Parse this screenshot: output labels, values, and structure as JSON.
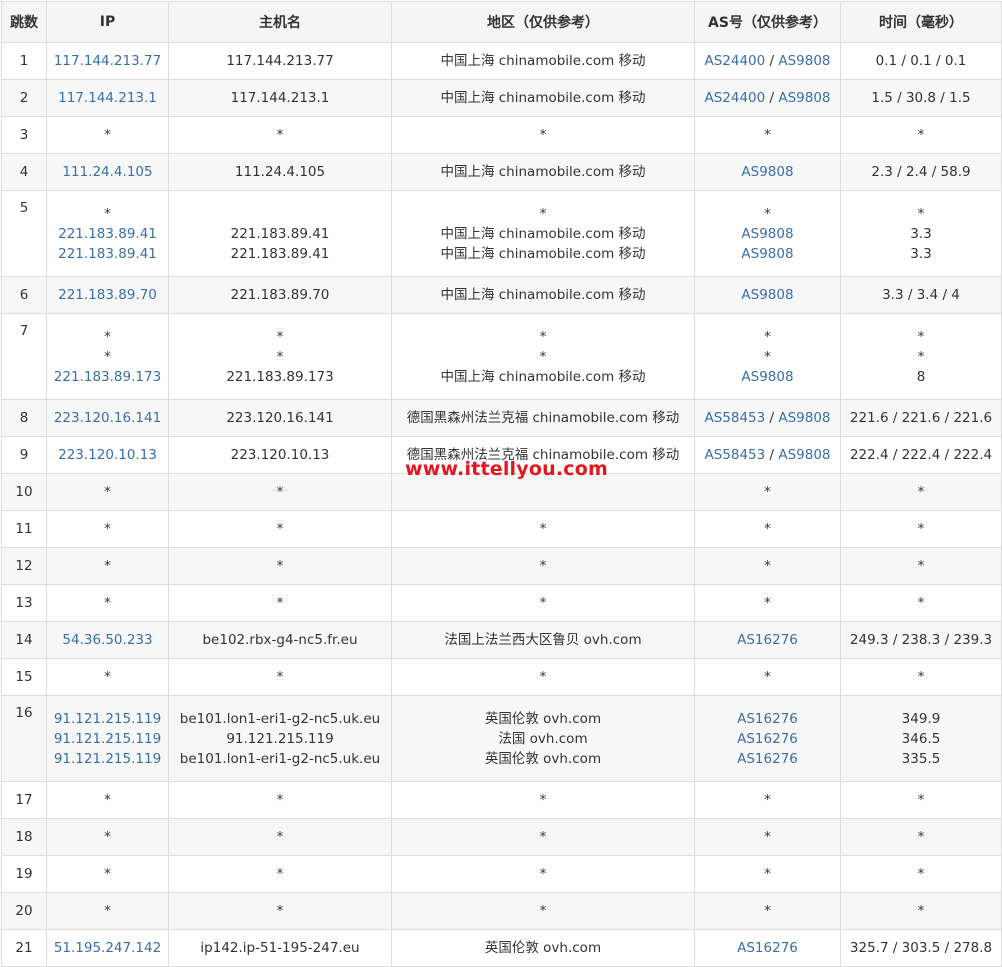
{
  "headers": [
    "跳数",
    "IP",
    "主机名",
    "地区（仅供参考）",
    "AS号（仅供参考）",
    "时间（毫秒）"
  ],
  "watermark": "www.ittellyou.com",
  "colors": {
    "link": "#3a6ea8",
    "watermark": "#e6161f",
    "border": "#dddddd",
    "stripe": "#f7f7f7"
  },
  "rows": [
    {
      "hop": "1",
      "lines": [
        {
          "ip": "117.144.213.77",
          "host": "117.144.213.77",
          "region": "中国上海 chinamobile.com 移动",
          "as": [
            "AS24400",
            "AS9808"
          ],
          "time": "0.1 / 0.1 / 0.1"
        }
      ]
    },
    {
      "hop": "2",
      "lines": [
        {
          "ip": "117.144.213.1",
          "host": "117.144.213.1",
          "region": "中国上海 chinamobile.com 移动",
          "as": [
            "AS24400",
            "AS9808"
          ],
          "time": "1.5 / 30.8 / 1.5"
        }
      ]
    },
    {
      "hop": "3",
      "lines": [
        {
          "ip": "*",
          "host": "*",
          "region": "*",
          "as": [
            "*"
          ],
          "time": "*"
        }
      ]
    },
    {
      "hop": "4",
      "lines": [
        {
          "ip": "111.24.4.105",
          "host": "111.24.4.105",
          "region": "中国上海 chinamobile.com 移动",
          "as": [
            "AS9808"
          ],
          "time": "2.3 / 2.4 / 58.9"
        }
      ]
    },
    {
      "hop": "5",
      "lines": [
        {
          "ip": "*",
          "host": "",
          "region": "*",
          "as": [
            "*"
          ],
          "time": "*"
        },
        {
          "ip": "221.183.89.41",
          "host": "221.183.89.41",
          "region": "中国上海 chinamobile.com 移动",
          "as": [
            "AS9808"
          ],
          "time": "3.3"
        },
        {
          "ip": "221.183.89.41",
          "host": "221.183.89.41",
          "region": "中国上海 chinamobile.com 移动",
          "as": [
            "AS9808"
          ],
          "time": "3.3"
        }
      ]
    },
    {
      "hop": "6",
      "lines": [
        {
          "ip": "221.183.89.70",
          "host": "221.183.89.70",
          "region": "中国上海 chinamobile.com 移动",
          "as": [
            "AS9808"
          ],
          "time": "3.3 / 3.4 / 4"
        }
      ]
    },
    {
      "hop": "7",
      "lines": [
        {
          "ip": "*",
          "host": "*",
          "region": "*",
          "as": [
            "*"
          ],
          "time": "*"
        },
        {
          "ip": "*",
          "host": "*",
          "region": "*",
          "as": [
            "*"
          ],
          "time": "*"
        },
        {
          "ip": "221.183.89.173",
          "host": "221.183.89.173",
          "region": "中国上海 chinamobile.com 移动",
          "as": [
            "AS9808"
          ],
          "time": "8"
        }
      ]
    },
    {
      "hop": "8",
      "lines": [
        {
          "ip": "223.120.16.141",
          "host": "223.120.16.141",
          "region": "德国黑森州法兰克福 chinamobile.com 移动",
          "as": [
            "AS58453",
            "AS9808"
          ],
          "time": "221.6 / 221.6 / 221.6"
        }
      ]
    },
    {
      "hop": "9",
      "lines": [
        {
          "ip": "223.120.10.13",
          "host": "223.120.10.13",
          "region": "德国黑森州法兰克福 chinamobile.com 移动",
          "as": [
            "AS58453",
            "AS9808"
          ],
          "time": "222.4 / 222.4 / 222.4"
        }
      ]
    },
    {
      "hop": "10",
      "lines": [
        {
          "ip": "*",
          "host": "*",
          "region": "",
          "as": [
            "*"
          ],
          "time": "*"
        }
      ]
    },
    {
      "hop": "11",
      "lines": [
        {
          "ip": "*",
          "host": "*",
          "region": "*",
          "as": [
            "*"
          ],
          "time": "*"
        }
      ]
    },
    {
      "hop": "12",
      "lines": [
        {
          "ip": "*",
          "host": "*",
          "region": "*",
          "as": [
            "*"
          ],
          "time": "*"
        }
      ]
    },
    {
      "hop": "13",
      "lines": [
        {
          "ip": "*",
          "host": "*",
          "region": "*",
          "as": [
            "*"
          ],
          "time": "*"
        }
      ]
    },
    {
      "hop": "14",
      "lines": [
        {
          "ip": "54.36.50.233",
          "host": "be102.rbx-g4-nc5.fr.eu",
          "region": "法国上法兰西大区鲁贝 ovh.com",
          "as": [
            "AS16276"
          ],
          "time": "249.3 / 238.3 / 239.3"
        }
      ]
    },
    {
      "hop": "15",
      "lines": [
        {
          "ip": "*",
          "host": "*",
          "region": "*",
          "as": [
            "*"
          ],
          "time": "*"
        }
      ]
    },
    {
      "hop": "16",
      "lines": [
        {
          "ip": "91.121.215.119",
          "host": "be101.lon1-eri1-g2-nc5.uk.eu",
          "region": "英国伦敦 ovh.com",
          "as": [
            "AS16276"
          ],
          "time": "349.9"
        },
        {
          "ip": "91.121.215.119",
          "host": "91.121.215.119",
          "region": "法国 ovh.com",
          "as": [
            "AS16276"
          ],
          "time": "346.5"
        },
        {
          "ip": "91.121.215.119",
          "host": "be101.lon1-eri1-g2-nc5.uk.eu",
          "region": "英国伦敦 ovh.com",
          "as": [
            "AS16276"
          ],
          "time": "335.5"
        }
      ]
    },
    {
      "hop": "17",
      "lines": [
        {
          "ip": "*",
          "host": "*",
          "region": "*",
          "as": [
            "*"
          ],
          "time": "*"
        }
      ]
    },
    {
      "hop": "18",
      "lines": [
        {
          "ip": "*",
          "host": "*",
          "region": "*",
          "as": [
            "*"
          ],
          "time": "*"
        }
      ]
    },
    {
      "hop": "19",
      "lines": [
        {
          "ip": "*",
          "host": "*",
          "region": "*",
          "as": [
            "*"
          ],
          "time": "*"
        }
      ]
    },
    {
      "hop": "20",
      "lines": [
        {
          "ip": "*",
          "host": "*",
          "region": "*",
          "as": [
            "*"
          ],
          "time": "*"
        }
      ]
    },
    {
      "hop": "21",
      "lines": [
        {
          "ip": "51.195.247.142",
          "host": "ip142.ip-51-195-247.eu",
          "region": "英国伦敦 ovh.com",
          "as": [
            "AS16276"
          ],
          "time": "325.7 / 303.5 / 278.8"
        }
      ]
    }
  ]
}
